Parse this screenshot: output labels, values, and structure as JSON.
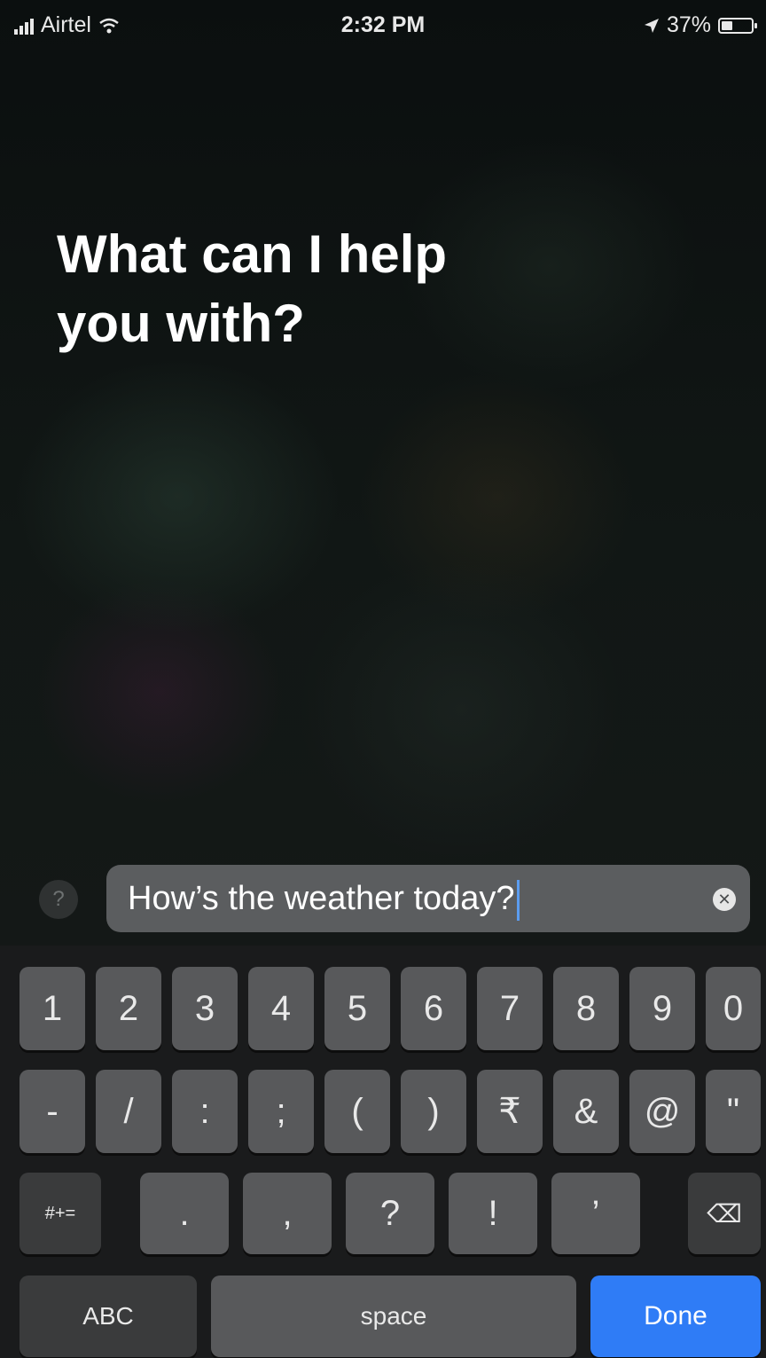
{
  "status_bar": {
    "carrier": "Airtel",
    "time": "2:32 PM",
    "battery": "37%",
    "battery_level": 0.37,
    "icons": [
      "signal-bars-icon",
      "wifi-icon",
      "location-arrow-icon",
      "battery-icon"
    ]
  },
  "siri": {
    "prompt_line1": "What can I help",
    "prompt_line2": "you with?",
    "help_label": "?"
  },
  "input": {
    "value": "How’s the weather today?",
    "clear_icon": "clear-x-icon"
  },
  "keyboard": {
    "row1": [
      "1",
      "2",
      "3",
      "4",
      "5",
      "6",
      "7",
      "8",
      "9",
      "0"
    ],
    "row2": [
      "-",
      "/",
      ":",
      ";",
      "(",
      ")",
      "₹",
      "&",
      "@",
      "\""
    ],
    "row3": [
      "#+=",
      ".",
      ",",
      "?",
      "!",
      "’",
      "⌫"
    ],
    "row4": [
      "ABC",
      "space",
      "Done"
    ]
  },
  "colors": {
    "done_key": "#2f7cf6",
    "key": "#58595b",
    "key_dark": "#3a3b3c",
    "input_bg": "#5b5d5f"
  }
}
